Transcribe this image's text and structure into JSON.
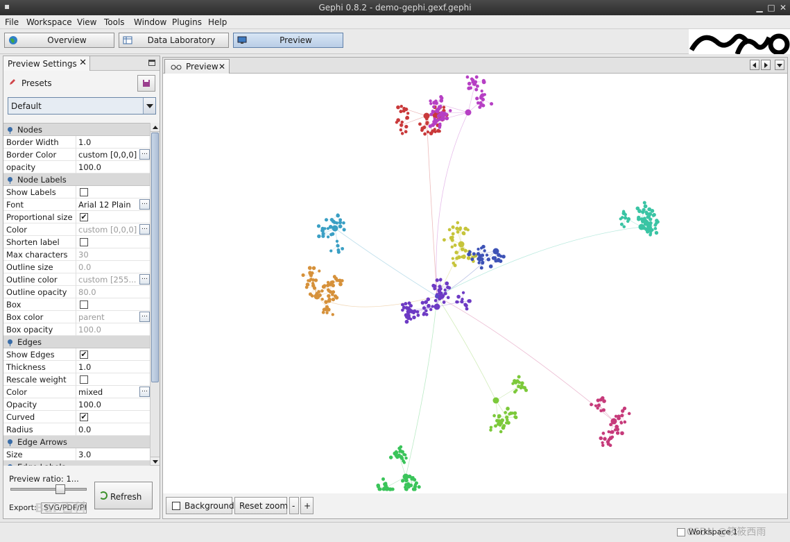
{
  "window": {
    "title": "Gephi 0.8.2 - demo-gephi.gexf.gephi"
  },
  "menu": [
    "File",
    "Workspace",
    "View",
    "Tools",
    "Window",
    "Plugins",
    "Help"
  ],
  "toolbar": {
    "overview": "Overview",
    "data_laboratory": "Data Laboratory",
    "preview": "Preview"
  },
  "left_panel": {
    "tab_title": "Preview Settings",
    "presets_label": "Presets",
    "preset_value": "Default",
    "preview_ratio": "Preview ratio: 1...",
    "refresh_label": "Refresh",
    "export_label": "Export:",
    "export_value": "SVG/PDF/PI"
  },
  "properties": [
    {
      "type": "category",
      "label": "Nodes"
    },
    {
      "label": "Border Width",
      "value": "1.0"
    },
    {
      "label": "Border Color",
      "value": "custom [0,0,0]",
      "button": true
    },
    {
      "label": "opacity",
      "value": "100.0"
    },
    {
      "type": "category",
      "label": "Node Labels"
    },
    {
      "label": "Show Labels",
      "checkbox": false
    },
    {
      "label": "Font",
      "value": "Arial 12 Plain",
      "button": true
    },
    {
      "label": "Proportional size",
      "checkbox": true
    },
    {
      "label": "Color",
      "value": "custom [0,0,0]",
      "button": true,
      "dim": true
    },
    {
      "label": "Shorten label",
      "checkbox": false
    },
    {
      "label": "Max characters",
      "value": "30",
      "dim": true
    },
    {
      "label": "Outline size",
      "value": "0.0",
      "dim": true
    },
    {
      "label": "Outline color",
      "value": "custom [255...",
      "button": true,
      "dim": true
    },
    {
      "label": "Outline opacity",
      "value": "80.0",
      "dim": true
    },
    {
      "label": "Box",
      "checkbox": false
    },
    {
      "label": "Box color",
      "value": "parent",
      "button": true,
      "dim": true
    },
    {
      "label": "Box opacity",
      "value": "100.0",
      "dim": true
    },
    {
      "type": "category",
      "label": "Edges"
    },
    {
      "label": "Show Edges",
      "checkbox": true
    },
    {
      "label": "Thickness",
      "value": "1.0"
    },
    {
      "label": "Rescale weight",
      "checkbox": false
    },
    {
      "label": "Color",
      "value": "mixed",
      "button": true
    },
    {
      "label": "Opacity",
      "value": "100.0"
    },
    {
      "label": "Curved",
      "checkbox": true
    },
    {
      "label": "Radius",
      "value": "0.0"
    },
    {
      "type": "category",
      "label": "Edge Arrows"
    },
    {
      "label": "Size",
      "value": "3.0"
    },
    {
      "type": "category",
      "label": "Edge Labels"
    }
  ],
  "preview": {
    "tab_title": "Preview",
    "background_label": "Background",
    "reset_zoom": "Reset zoom",
    "zoom_out": "-",
    "zoom_in": "+"
  },
  "status": {
    "workspace": "Workspace 1",
    "watermark": "CSDN @筱筱西雨"
  },
  "graph_clusters": [
    {
      "color": "#c9393a",
      "n": 44
    },
    {
      "color": "#b63fc4",
      "n": 70
    },
    {
      "color": "#3a9fc4",
      "n": 26
    },
    {
      "color": "#d6913a",
      "n": 60
    },
    {
      "color": "#c6c43a",
      "n": 30
    },
    {
      "color": "#3d52b6",
      "n": 28
    },
    {
      "color": "#3ac4a4",
      "n": 52
    },
    {
      "color": "#6d3ac4",
      "n": 72
    },
    {
      "color": "#3ac45a",
      "n": 62
    },
    {
      "color": "#7cc93a",
      "n": 42
    },
    {
      "color": "#c63a7a",
      "n": 38
    }
  ]
}
